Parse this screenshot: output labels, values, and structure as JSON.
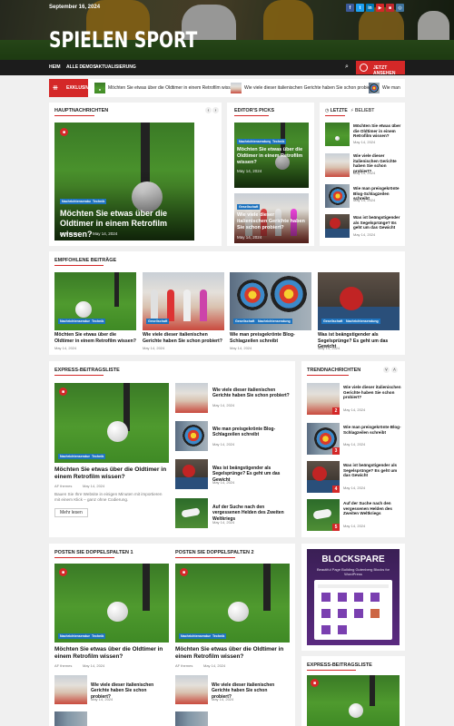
{
  "header": {
    "date": "September 16, 2024",
    "logo": "SPIELEN SPORT",
    "social": [
      {
        "icon": "f",
        "color": "#3b5998"
      },
      {
        "icon": "t",
        "color": "#1da1f2"
      },
      {
        "icon": "in",
        "color": "#0077b5"
      },
      {
        "icon": "▶",
        "color": "#d42828"
      },
      {
        "icon": "■",
        "color": "#c1272d"
      },
      {
        "icon": "◎",
        "color": "#3f729b"
      }
    ]
  },
  "nav": {
    "items": [
      "HEIM",
      "ALLE DEMOS",
      "AKTUALISIERUNG"
    ],
    "watch": "JETZT ANSEHEN"
  },
  "ticker": {
    "label": "EXKLUSIV",
    "items": [
      "Möchten Sie etwas über die Oldtimer in einem Retrofilm wissen?",
      "Wie viele dieser italienischen Gerichte haben Sie schon probiert?",
      "Wie man"
    ]
  },
  "cats": {
    "a": "Nachrichtensendung",
    "b": "Technik",
    "c": "Gesellschaft"
  },
  "date": "May 14, 2024",
  "author": "AF themes",
  "titles": {
    "t1": "Möchten Sie etwas über die Oldtimer in einem Retrofilm wissen?",
    "t2": "Wie viele dieser italienischen Gerichte haben Sie schon probiert?",
    "t3": "Wie man preisgekrönte Blog-Schlagzeilen schreibt",
    "t4": "Was ist beängstigender als Segelsprünge? Es geht um das Gewicht",
    "t5": "Auf der Suche nach den vergessenen Helden des Zweiten Weltkriegs"
  },
  "sections": {
    "main": "HAUPTNACHRICHTEN",
    "editors": "EDITOR'S PICKS",
    "latest": "LETZTE",
    "popular": "BELIEBT",
    "featured": "EMPFOHLENE BEITRÄGE",
    "express": "EXPRESS-BEITRAGSLISTE",
    "trending": "TRENDNACHRICHTEN",
    "double1": "POSTEN SIE DOPPELSPALTEN 1",
    "double2": "POSTEN SIE DOPPELSPALTEN 2",
    "express2": "EXPRESS-BEITRAGSLISTE"
  },
  "excerpt": "Bauen Sie Ihre Website in einigen Minuten mit importieren mit einem Klick – ganz ohne Codierung.",
  "readmore": "Mehr lesen",
  "ad": {
    "title": "BLOCKSPARE",
    "subtitle": "Beautiful Page Building Gutenberg Blocks for WordPress"
  },
  "colors": {
    "accent": "#d42828",
    "badge": "#1e73be"
  }
}
